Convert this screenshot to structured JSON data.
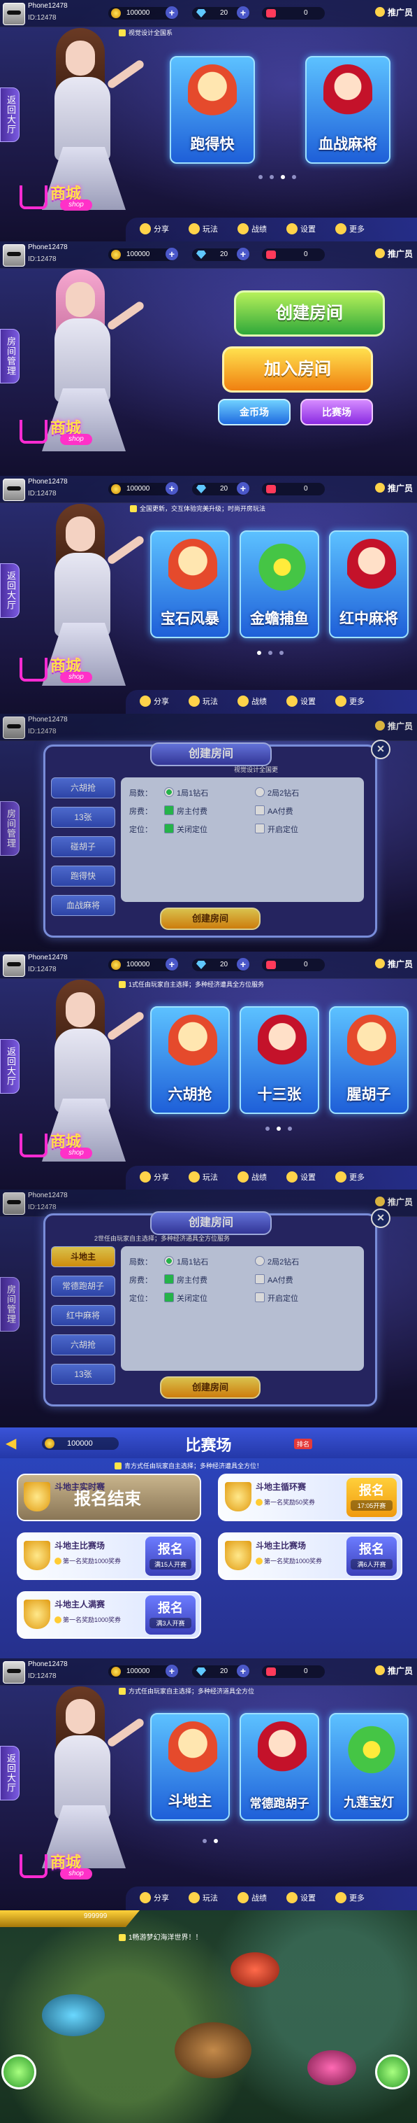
{
  "common": {
    "player_name": "Phone12478",
    "player_id": "ID:12478",
    "coins": "100000",
    "gems": "20",
    "hearts": "0",
    "promoter": "推广员",
    "bottom_nav": [
      "分享",
      "玩法",
      "战绩",
      "设置",
      "更多"
    ],
    "shop_title": "商城",
    "shop_sub": "shop",
    "return_lobby": "返回大厅",
    "room_manage": "房间管理",
    "icons": {
      "coin": "coin-icon",
      "gem": "gem-icon",
      "heart": "heart-icon",
      "plus": "plus-icon",
      "back": "back-arrow-icon"
    }
  },
  "panel1": {
    "ticker": "视觉设计全国系",
    "games": [
      "跑得快",
      "血战麻将"
    ]
  },
  "panel2": {
    "create_room": "创建房间",
    "join_room": "加入房间",
    "gold_field": "金币场",
    "match_field": "比赛场"
  },
  "panel3": {
    "ticker": "全国更新，交互体验完美升级；时尚开房玩法",
    "games": [
      "宝石风暴",
      "金蟾捕鱼",
      "红中麻将"
    ]
  },
  "panel4": {
    "title": "创建房间",
    "subtitle": "视觉设计全国更",
    "tabs": [
      "六胡抢",
      "13张",
      "碰胡子",
      "跑得快",
      "血战麻将"
    ],
    "rows": [
      {
        "key": "局数：",
        "opts": [
          "1局1钻石",
          "2局2钻石"
        ]
      },
      {
        "key": "房费：",
        "opts": [
          "房主付费",
          "AA付费"
        ]
      },
      {
        "key": "定位：",
        "opts": [
          "关闭定位",
          "开启定位"
        ]
      }
    ],
    "create_button": "创建房间"
  },
  "panel5": {
    "ticker": "1式任由玩家自主选择；多种经济遭具全方位服务",
    "games": [
      "六胡抢",
      "十三张",
      "腥胡子"
    ]
  },
  "panel6": {
    "title": "创建房间",
    "subtitle": "2世任由玩家自主选择；多种经济通具全方位服务",
    "tabs": [
      "斗地主",
      "常德跑胡子",
      "红中麻将",
      "六胡抢",
      "13张"
    ],
    "rows": [
      {
        "key": "局数：",
        "opts": [
          "1局1钻石",
          "2局2钻石"
        ]
      },
      {
        "key": "房费：",
        "opts": [
          "房主付费",
          "AA付费"
        ]
      },
      {
        "key": "定位：",
        "opts": [
          "关闭定位",
          "开启定位"
        ]
      }
    ],
    "create_button": "创建房间"
  },
  "panel7": {
    "title": "比赛场",
    "coins": "100000",
    "ticker": "青方式任由玩家自主选择；多种经济遭具全方位！",
    "rank_tag": "排名",
    "cards": [
      {
        "name": "斗地主实时赛",
        "overlay": "报名结束",
        "reward": "",
        "button": "",
        "state": "over"
      },
      {
        "name": "斗地主循环赛",
        "reward": "第一名奖励50奖券",
        "button": "报名",
        "sub": "17:05开赛",
        "state": "gold"
      },
      {
        "name": "斗地主比赛场",
        "reward": "第一名奖励1000奖券",
        "button": "报名",
        "sub": "满15人开赛",
        "state": "normal"
      },
      {
        "name": "斗地主比赛场",
        "reward": "第一名奖励1000奖券",
        "button": "报名",
        "sub": "满6人开赛",
        "state": "normal"
      },
      {
        "name": "斗地主人满赛",
        "reward": "第一名奖励1000奖券",
        "button": "报名",
        "sub": "满3人开赛",
        "state": "normal"
      }
    ]
  },
  "panel8": {
    "ticker": "方式任由玩家自主选择；多种经济道具全方位",
    "games": [
      "斗地主",
      "常德跑胡子",
      "九莲宝灯"
    ]
  },
  "panel9": {
    "ticker": "1畅游梦幻海洋世界！！",
    "score": "999999"
  }
}
